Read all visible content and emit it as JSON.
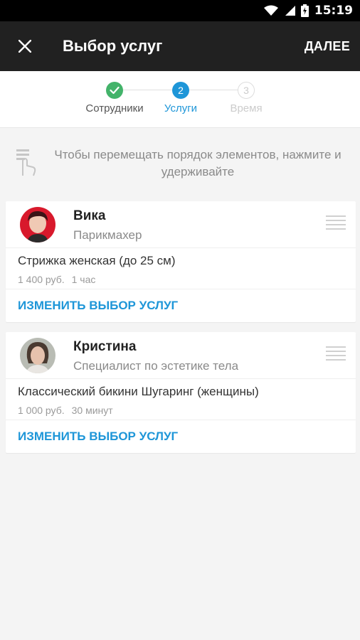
{
  "status_bar": {
    "time": "15:19",
    "icons": [
      "wifi-icon",
      "signal-icon",
      "battery-charging-icon"
    ]
  },
  "app_bar": {
    "title": "Выбор услуг",
    "next_label": "ДАЛЕЕ",
    "close_icon": "close-icon"
  },
  "stepper": {
    "steps": [
      {
        "label": "Сотрудники",
        "state": "done",
        "number": ""
      },
      {
        "label": "Услуги",
        "state": "active",
        "number": "2"
      },
      {
        "label": "Время",
        "state": "pending",
        "number": "3"
      }
    ]
  },
  "hint": {
    "icon": "touch-hold-icon",
    "text": "Чтобы перемещать порядок элементов, нажмите и удерживайте"
  },
  "cards": [
    {
      "name": "Вика",
      "role": "Парикмахер",
      "service": "Стрижка женская (до 25 см)",
      "price": "1 400 руб.",
      "duration": "1 час",
      "action_label": "ИЗМЕНИТЬ ВЫБОР УСЛУГ"
    },
    {
      "name": "Кристина",
      "role": "Специалист по эстетике тела",
      "service": "Классический бикини Шугаринг (женщины)",
      "price": "1 000 руб.",
      "duration": "30 минут",
      "action_label": "ИЗМЕНИТЬ ВЫБОР УСЛУГ"
    }
  ],
  "colors": {
    "accent": "#1e96d8",
    "success": "#43b36a",
    "app_bar": "#212121"
  }
}
